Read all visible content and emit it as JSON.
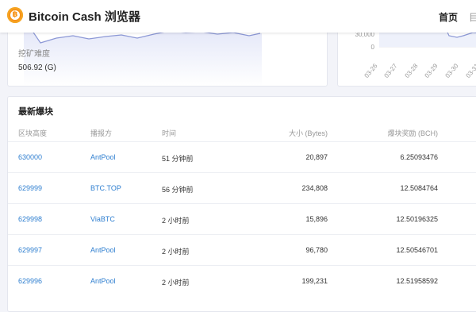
{
  "header": {
    "brand": "Bitcoin Cash 浏览器",
    "nav": [
      {
        "label": "首页",
        "active": true
      },
      {
        "label": "目"
      }
    ],
    "logo_icon": "bitcoin-cash-logo"
  },
  "difficulty": {
    "label": "挖矿难度",
    "value": "506.92 (G)"
  },
  "hashrate_chart": {
    "y_ticks": [
      "30,000",
      "0"
    ],
    "x_ticks": [
      "03-26",
      "03-27",
      "03-28",
      "03-29",
      "03-30",
      "03-31"
    ]
  },
  "latest_blocks": {
    "title": "最新爆块",
    "columns": [
      "区块高度",
      "播报方",
      "时间",
      "大小 (Bytes)",
      "爆块奖励 (BCH)"
    ],
    "rows": [
      {
        "height": "630000",
        "miner": "AntPool",
        "time": "51 分钟前",
        "size": "20,897",
        "reward": "6.25093476"
      },
      {
        "height": "629999",
        "miner": "BTC.TOP",
        "time": "56 分钟前",
        "size": "234,808",
        "reward": "12.5084764"
      },
      {
        "height": "629998",
        "miner": "ViaBTC",
        "time": "2 小时前",
        "size": "15,896",
        "reward": "12.50196325"
      },
      {
        "height": "629997",
        "miner": "AntPool",
        "time": "2 小时前",
        "size": "96,780",
        "reward": "12.50546701"
      },
      {
        "height": "629996",
        "miner": "AntPool",
        "time": "2 小时前",
        "size": "199,231",
        "reward": "12.51958592"
      }
    ]
  }
}
